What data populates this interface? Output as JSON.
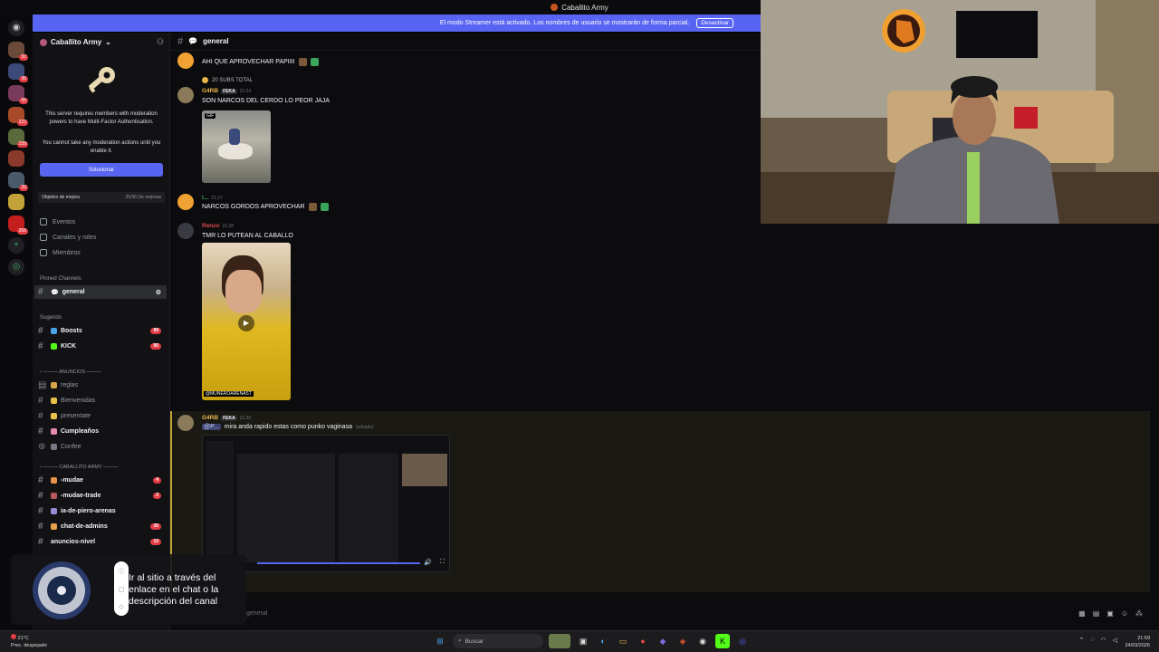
{
  "window": {
    "title": "Caballito Army"
  },
  "banner": {
    "text": "El modo Streamer está activado. Los nombres de usuario se mostrarán de forma parcial.",
    "button": "Desactivar"
  },
  "guilds": {
    "badges": [
      "92",
      "36",
      "65",
      "222",
      "239",
      "39",
      "266"
    ]
  },
  "server": {
    "name": "Caballito Army",
    "mfa_line1": "This server requires members with moderation powers to have Multi-Factor Authentication.",
    "mfa_line2": "You cannot take any moderation actions until you enable it.",
    "fix_button": "Solucionar",
    "boost_label": "Objetivo de mejora",
    "boost_value": "25/36 De mejoras",
    "nav": {
      "events": "Eventos",
      "channels_roles": "Canales y roles",
      "members": "Miembros"
    },
    "pinned_header": "Pinned Channels",
    "pinned_channel": "general",
    "suggested_header": "Sugerido",
    "suggested": [
      {
        "name": "Boosts",
        "count": "89"
      },
      {
        "name": "KICK",
        "count": "95"
      }
    ],
    "cat_anuncios": "ANUNCIOS",
    "anuncios": [
      {
        "name": "reglas"
      },
      {
        "name": "Bienvenidas"
      },
      {
        "name": "presentate"
      },
      {
        "name": "Cumpleaños"
      },
      {
        "name": "Confee"
      }
    ],
    "cat_army": "CABALLITO ARMY",
    "army": [
      {
        "name": "-mudae",
        "count": "4"
      },
      {
        "name": "-mudae-trade",
        "count": "2"
      },
      {
        "name": "ia-de-piero-arenas",
        "count": ""
      },
      {
        "name": "chat-de-admins",
        "count": "30"
      },
      {
        "name": "anuncios-nivel",
        "count": "10"
      }
    ]
  },
  "chat": {
    "channel": "general",
    "messages": [
      {
        "text": "AHI QUE APROVECHAR PAPIIII"
      },
      {
        "reply": "20 SUBS  TOTAL",
        "author": "G4RB",
        "tag": "FEKA",
        "time": "21:24",
        "text": "SON NARCOS DEL CERDO LO PEOR JAJA",
        "gif_label": "GIF"
      },
      {
        "author": "l...",
        "time": "21:27",
        "text": "NARCOS GORDOS APROVECHAR"
      },
      {
        "author": "Renzo",
        "time": "21:28",
        "text": "TMR LO PUTEAN AL CABALLO",
        "video_watermark": "@MUNEROARENAST"
      },
      {
        "author": "G4RB",
        "tag": "FEKA",
        "time": "21:30",
        "mention": "@P...",
        "text": "mira anda rapido estas como punko vaginasa",
        "edited": "(editado)"
      }
    ],
    "composer_placeholder": "general"
  },
  "promo": {
    "text": "Ir al sitio a través del enlace en el chat o la descripción del canal"
  },
  "taskbar": {
    "weather_temp": "21°C",
    "weather_desc": "Prec. despejado",
    "search": "Buscar",
    "time": "21:59",
    "date": "24/03/2026"
  }
}
